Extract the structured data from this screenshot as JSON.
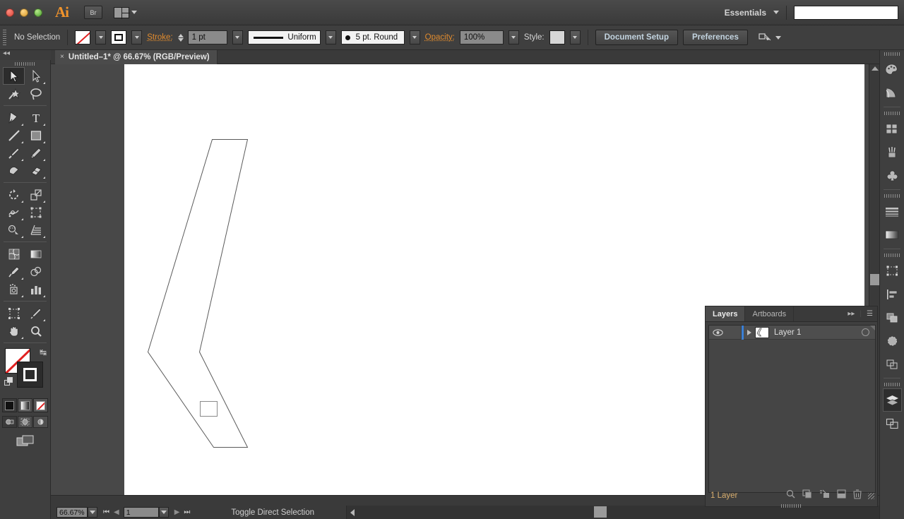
{
  "titlebar": {
    "app_initials": "Ai",
    "bridge_label": "Br",
    "arrange_icon": "arrange-documents-icon",
    "workspace": "Essentials",
    "search_value": ""
  },
  "control_bar": {
    "selection_status": "No Selection",
    "fill_swatch": "none-swatch",
    "stroke_swatch": "black-stroke-swatch",
    "stroke_label": "Stroke:",
    "stroke_weight": "1 pt",
    "stroke_profile": "Uniform",
    "brush_definition": "5 pt. Round",
    "opacity_label": "Opacity:",
    "opacity_value": "100%",
    "style_label": "Style:",
    "document_setup": "Document Setup",
    "preferences": "Preferences",
    "align_icon": "align-to-selection-icon"
  },
  "document_tab": {
    "close": "×",
    "title": "Untitled–1* @ 66.67% (RGB/Preview)"
  },
  "toolbar": {
    "groups": [
      [
        {
          "name": "selection-tool",
          "active": true,
          "corner": false
        },
        {
          "name": "direct-selection-tool",
          "active": false,
          "corner": true
        },
        {
          "name": "magic-wand-tool",
          "active": false,
          "corner": false
        },
        {
          "name": "lasso-tool",
          "active": false,
          "corner": false
        }
      ],
      [
        {
          "name": "pen-tool",
          "active": false,
          "corner": true
        },
        {
          "name": "type-tool",
          "active": false,
          "corner": true
        },
        {
          "name": "line-segment-tool",
          "active": false,
          "corner": true
        },
        {
          "name": "rectangle-tool",
          "active": false,
          "corner": true
        },
        {
          "name": "paintbrush-tool",
          "active": false,
          "corner": true
        },
        {
          "name": "pencil-tool",
          "active": false,
          "corner": true
        },
        {
          "name": "blob-brush-tool",
          "active": false,
          "corner": false
        },
        {
          "name": "eraser-tool",
          "active": false,
          "corner": true
        }
      ],
      [
        {
          "name": "rotate-tool",
          "active": false,
          "corner": true
        },
        {
          "name": "scale-tool",
          "active": false,
          "corner": true
        },
        {
          "name": "width-tool",
          "active": false,
          "corner": true
        },
        {
          "name": "free-transform-tool",
          "active": false,
          "corner": false
        },
        {
          "name": "shape-builder-tool",
          "active": false,
          "corner": true
        },
        {
          "name": "perspective-grid-tool",
          "active": false,
          "corner": true
        }
      ],
      [
        {
          "name": "mesh-tool",
          "active": false,
          "corner": false
        },
        {
          "name": "gradient-tool",
          "active": false,
          "corner": false
        },
        {
          "name": "eyedropper-tool",
          "active": false,
          "corner": true
        },
        {
          "name": "blend-tool",
          "active": false,
          "corner": false
        },
        {
          "name": "symbol-sprayer-tool",
          "active": false,
          "corner": true
        },
        {
          "name": "column-graph-tool",
          "active": false,
          "corner": true
        }
      ],
      [
        {
          "name": "artboard-tool",
          "active": false,
          "corner": false
        },
        {
          "name": "slice-tool",
          "active": false,
          "corner": true
        },
        {
          "name": "hand-tool",
          "active": false,
          "corner": true
        },
        {
          "name": "zoom-tool",
          "active": false,
          "corner": false
        }
      ]
    ],
    "fill_stroke": {
      "fill": "none-swatch",
      "stroke": "black-stroke-swatch",
      "swap_icon": "swap-fill-stroke-icon",
      "default_icon": "default-fill-stroke-icon"
    },
    "color_modes": [
      "color-button",
      "gradient-button",
      "none-button"
    ],
    "draw_modes": [
      "draw-normal-button",
      "draw-behind-button",
      "draw-inside-button"
    ],
    "screen_mode": "change-screen-mode-icon"
  },
  "canvas": {
    "shape_name": "chevron-path",
    "stroke_color": "#5a5a5a",
    "fill": "none",
    "artboard_color": "#ffffff",
    "background_color": "#484848",
    "overlay_rect": "selection-preview-rectangle"
  },
  "status_bar": {
    "zoom_level": "66.67%",
    "artboard_number": "1",
    "status_text": "Toggle Direct Selection",
    "first_icon": "first-artboard-icon",
    "prev_icon": "previous-artboard-icon",
    "next_icon": "next-artboard-icon",
    "last_icon": "last-artboard-icon"
  },
  "right_dock": {
    "items": [
      {
        "name": "color-panel-icon",
        "active": false
      },
      {
        "name": "color-guide-panel-icon",
        "active": false
      },
      {
        "name": "swatches-panel-icon",
        "active": false
      },
      {
        "name": "brushes-panel-icon",
        "active": false
      },
      {
        "name": "symbols-panel-icon",
        "active": false
      },
      {
        "name": "stroke-panel-icon",
        "active": false
      },
      {
        "name": "gradient-panel-icon",
        "active": false
      },
      {
        "name": "transform-panel-icon",
        "active": false
      },
      {
        "name": "align-panel-icon",
        "active": false
      },
      {
        "name": "pathfinder-panel-icon",
        "active": false
      },
      {
        "name": "transparency-panel-icon",
        "active": false
      },
      {
        "name": "appearance-panel-icon",
        "active": false
      },
      {
        "name": "layers-panel-icon",
        "active": true
      },
      {
        "name": "artboards-panel-icon",
        "active": false
      }
    ]
  },
  "layers_panel": {
    "tabs": [
      {
        "label": "Layers",
        "active": true
      },
      {
        "label": "Artboards",
        "active": false
      }
    ],
    "collapse_icon": "collapse-to-icons-icon",
    "menu_icon": "panel-menu-icon",
    "rows": [
      {
        "name": "Layer 1",
        "visible": true,
        "locked": false,
        "color": "#3a7fd5",
        "eye_icon": "eye-icon",
        "disclosure_icon": "disclosure-triangle-icon",
        "thumbnail": "layer-thumbnail",
        "target_icon": "target-circle-icon"
      }
    ],
    "footer_count": "1 Layer",
    "footer_icons": [
      "locate-object-icon",
      "make-clipping-mask-icon",
      "create-new-sublayer-icon",
      "create-new-layer-icon",
      "delete-selection-icon"
    ]
  }
}
